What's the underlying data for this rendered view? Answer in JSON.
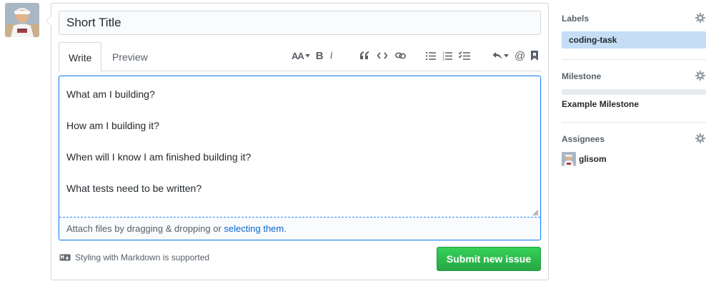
{
  "issue": {
    "title_value": "Short Title",
    "body_lines": [
      "What am I building?",
      "How am I building it?",
      "When will I know I am finished building it?",
      "What tests need to be written?"
    ]
  },
  "tabs": [
    {
      "label": "Write",
      "active": true
    },
    {
      "label": "Preview",
      "active": false
    }
  ],
  "toolbar": {
    "icons": [
      "text-size-icon",
      "bold-icon",
      "italic-icon",
      "quote-icon",
      "code-icon",
      "link-icon",
      "unordered-list-icon",
      "ordered-list-icon",
      "task-list-icon",
      "reply-icon",
      "mention-icon",
      "bookmark-icon"
    ],
    "text_size_label": "AA",
    "bold_label": "B",
    "italic_label": "i",
    "mention_label": "@"
  },
  "attach": {
    "prefix": "Attach files by dragging & dropping or ",
    "link": "selecting them",
    "suffix": "."
  },
  "footer": {
    "markdown_note": "Styling with Markdown is supported",
    "markdown_icon": "markdown-icon",
    "submit_label": "Submit new issue"
  },
  "sidebar": {
    "labels": {
      "heading": "Labels",
      "items": [
        "coding-task"
      ],
      "item_color": "#c5def5"
    },
    "milestone": {
      "heading": "Milestone",
      "name": "Example Milestone",
      "progress": 0
    },
    "assignees": {
      "heading": "Assignees",
      "users": [
        "glisom"
      ]
    }
  },
  "colors": {
    "submit_green": "#2cbe4e",
    "link_blue": "#0366d6",
    "focus_blue": "#2188ff"
  }
}
